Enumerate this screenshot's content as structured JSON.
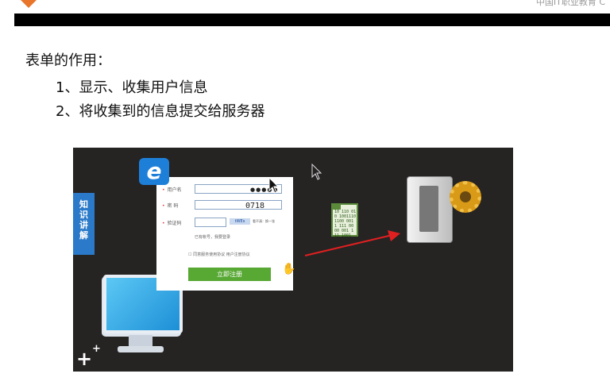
{
  "header": {
    "brand_text": "中国IT职业教育 C",
    "logo_color": "#e8752a"
  },
  "slide": {
    "heading": "表单的作用：",
    "points": [
      "1、显示、收集用户信息",
      "2、将收集到的信息提交给服务器"
    ]
  },
  "video": {
    "side_tab": [
      "知",
      "识",
      "讲",
      "解"
    ],
    "browser_icon": "ie-icon",
    "form": {
      "username_label": "用户名",
      "password_label": "密  码",
      "password_value": "●●●●●",
      "code_label": "验证码",
      "code_value": "0718",
      "captcha_text": "tWEs",
      "captcha_note": "看不清：换一张",
      "have_account": "已有帐号，我要登录",
      "agree_text": "同意服务使用协议  用户注册协议",
      "submit_label": "立即注册"
    },
    "file_text": "10 110 01\n0 1001110\n1100 001\n1 111 00\n00 001 1\n11 1001",
    "plus_icon": "plus-icon"
  }
}
